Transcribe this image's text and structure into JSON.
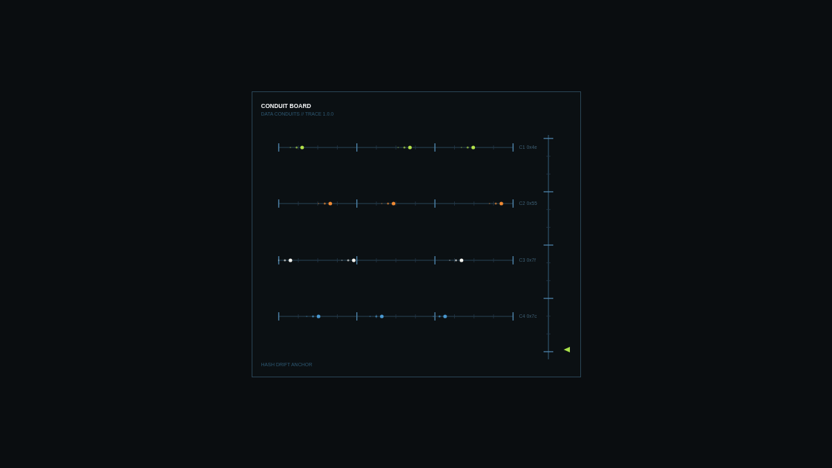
{
  "board": {
    "title": "CONDUIT BOARD",
    "subtitle": "DATA CONDUITS // TRACE 1.0.0",
    "footer": "HASH DRIFT ANCHOR"
  },
  "conduits": [
    {
      "label": "C1 0x4e",
      "color": "#b4e24a"
    },
    {
      "label": "C2 0x55",
      "color": "#f08a34"
    },
    {
      "label": "C3 0x7f",
      "color": "#f2f2ee"
    },
    {
      "label": "C4 0x7c",
      "color": "#4a98d0"
    }
  ]
}
